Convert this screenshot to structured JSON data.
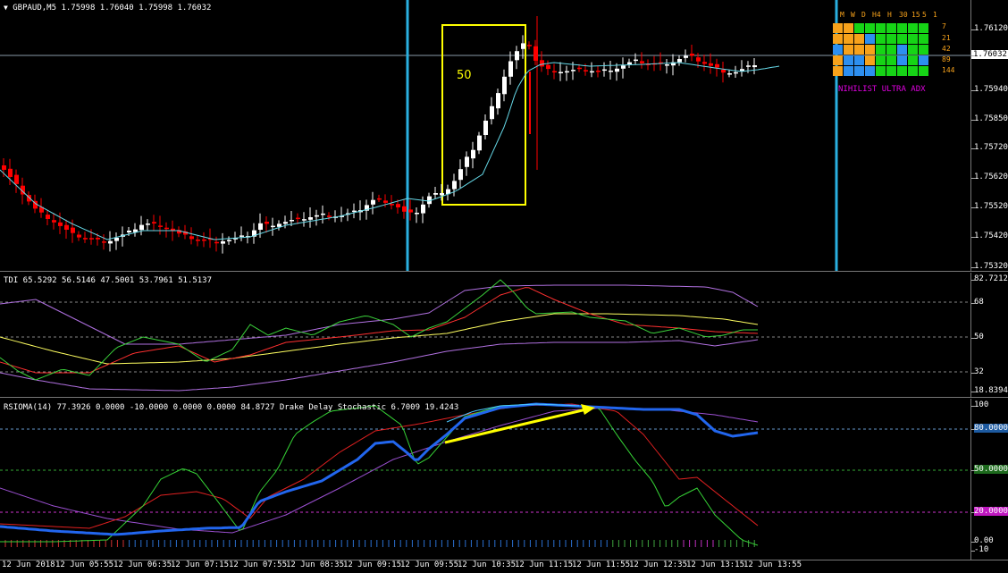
{
  "main": {
    "title_arrow": "▼",
    "symbol_tf": "GBPAUD,M5",
    "ohlc": "1.75998 1.76040 1.75998 1.76032",
    "box_label": "50",
    "price_axis": [
      "1.76120",
      "1.76032",
      "1.75940",
      "1.75850",
      "1.75720",
      "1.75620",
      "1.75520",
      "1.75420",
      "1.75320"
    ],
    "current_price": "1.76032"
  },
  "adx": {
    "timeframes": [
      "M",
      "W",
      "D",
      "H4",
      "H",
      "30",
      "15",
      "5",
      "1"
    ],
    "periods": [
      "7",
      "21",
      "42",
      "89",
      "144"
    ],
    "label": "NIHILIST ULTRA ADX",
    "colors": {
      "orange": "#f7a21b",
      "blue": "#2d8ff0",
      "green": "#16d416"
    }
  },
  "tdi": {
    "header": "TDI 65.5292 56.5146 47.5001 53.7961 51.5137",
    "axis": [
      "82.7212",
      "68",
      "50",
      "32",
      "18.8394"
    ]
  },
  "rsioma": {
    "header": "RSIOMA(14) 77.3926 0.0000 -10.0000 0.0000 0.0000 84.8727  Drake Delay Stochastic 6.7009 19.4243",
    "axis_plain": [
      "100",
      "0.00",
      "-10"
    ],
    "axis_boxed": [
      "80.0000",
      "50.0000",
      "20.0000"
    ]
  },
  "time_axis": [
    "12 Jun 2018",
    "12 Jun 05:55",
    "12 Jun 06:35",
    "12 Jun 07:15",
    "12 Jun 07:55",
    "12 Jun 08:35",
    "12 Jun 09:15",
    "12 Jun 09:55",
    "12 Jun 10:35",
    "12 Jun 11:15",
    "12 Jun 11:55",
    "12 Jun 12:35",
    "12 Jun 13:15",
    "12 Jun 13:55"
  ],
  "colors": {
    "bull": "#ffffff",
    "bear": "#ff0000",
    "vline": "#2ab0e0",
    "box": "#ffff00"
  }
}
